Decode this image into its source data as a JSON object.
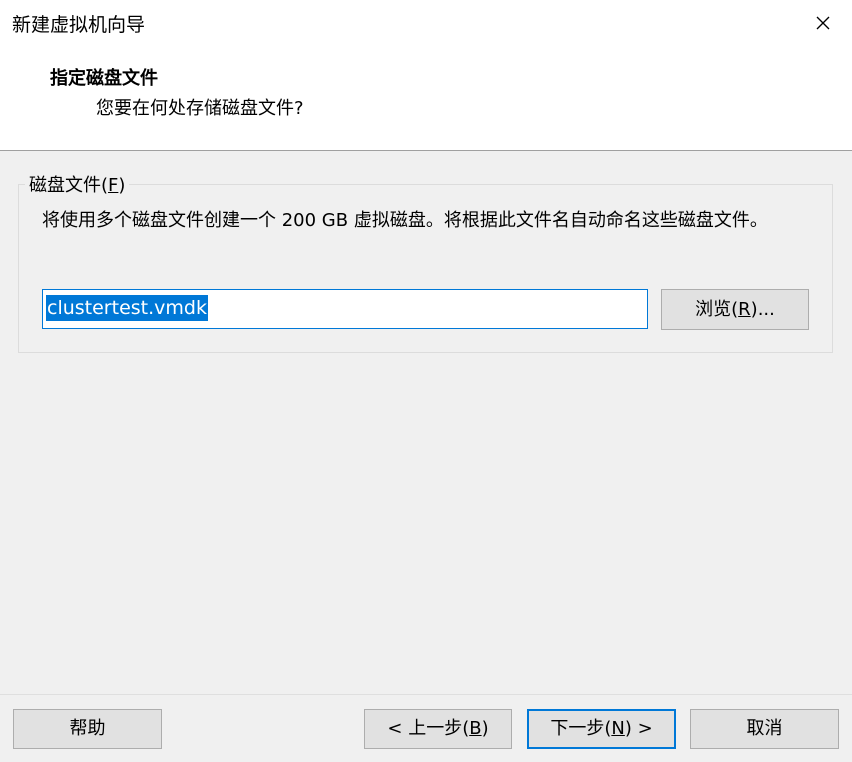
{
  "window": {
    "title": "新建虚拟机向导"
  },
  "header": {
    "page_title": "指定磁盘文件",
    "page_subtitle": "您要在何处存储磁盘文件?"
  },
  "disk_group": {
    "label_prefix": "磁盘文件(",
    "label_mnemonic": "F",
    "label_suffix": ")",
    "description": "将使用多个磁盘文件创建一个 200 GB 虚拟磁盘。将根据此文件名自动命名这些磁盘文件。",
    "file_value": "clustertest.vmdk",
    "browse_prefix": "浏览(",
    "browse_mnemonic": "R",
    "browse_suffix": ")..."
  },
  "footer": {
    "help_label": "帮助",
    "back_prefix": "< 上一步(",
    "back_mnemonic": "B",
    "back_suffix": ")",
    "next_prefix": "下一步(",
    "next_mnemonic": "N",
    "next_suffix": ") >",
    "cancel_label": "取消"
  },
  "colors": {
    "accent": "#0078d7",
    "header_bg": "#ffffff",
    "body_bg": "#f0f0f0",
    "button_bg": "#e1e1e1"
  },
  "icons": {
    "close": "close-icon"
  }
}
